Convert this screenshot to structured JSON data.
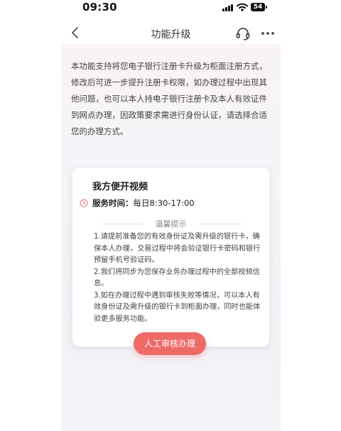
{
  "status_bar": {
    "time": "09:30",
    "battery": "54"
  },
  "nav": {
    "title": "功能升级"
  },
  "intro_text": "本功能支持将您电子银行注册卡升级为柜面注册方式，修改后可进一步提升注册卡权限，如办理过程中出现其他问题，也可以本人持电子银行注册卡及本人有效证件到网点办理，因政策要求需进行身份认证，请选择合适您的办理方式。",
  "card": {
    "title": "我方便开视频",
    "service_label": "服务时间：",
    "service_value": "每日8:30-17:00",
    "tips_title": "温馨提示",
    "tips": [
      "1.请提前准备您的有效身份证及需升级的银行卡，确保本人办理，交易过程中将会验证银行卡密码和银行预留手机号验证码。",
      "2.我们将同步为您保存业务办理过程中的全部视频信息。",
      "3.如在办理过程中遇到审核失败等情况，可以本人有效身份证及需升级的银行卡到柜面办理，同时也能体验更多服务功能。"
    ]
  },
  "button": {
    "label": "人工审核办理"
  },
  "icons": {
    "back": "chevron-left-icon",
    "support": "headset-icon",
    "more": "more-dots-icon",
    "clock": "clock-icon"
  },
  "colors": {
    "accent": "#ee6a67",
    "clock": "#e8877f"
  }
}
